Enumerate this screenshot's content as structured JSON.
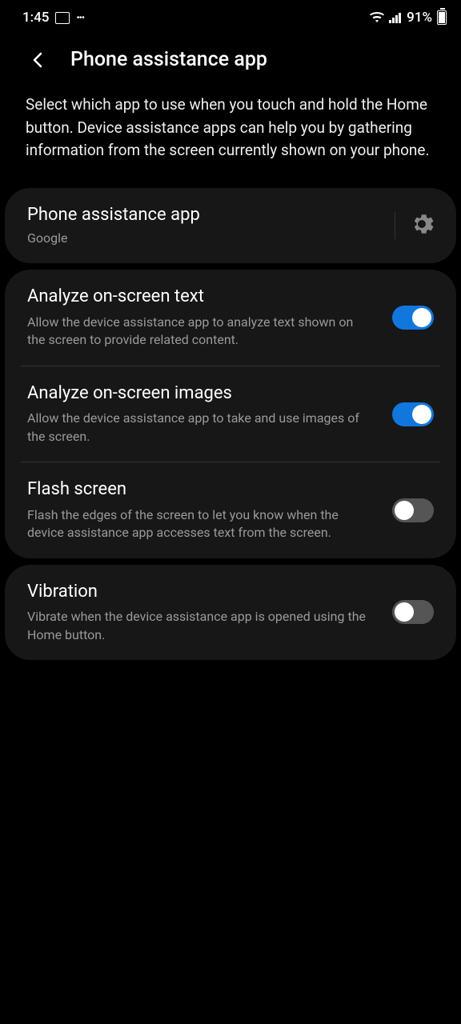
{
  "statusBar": {
    "time": "1:45",
    "batteryPercent": "91%"
  },
  "header": {
    "title": "Phone assistance app"
  },
  "description": "Select which app to use when you touch and hold the Home button. Device assistance apps can help you by gathering information from the screen currently shown on your phone.",
  "currentApp": {
    "label": "Phone assistance app",
    "value": "Google"
  },
  "settings": {
    "analyzeText": {
      "title": "Analyze on-screen text",
      "description": "Allow the device assistance app to analyze text shown on the screen to provide related content.",
      "enabled": true
    },
    "analyzeImages": {
      "title": "Analyze on-screen images",
      "description": "Allow the device assistance app to take and use images of the screen.",
      "enabled": true
    },
    "flashScreen": {
      "title": "Flash screen",
      "description": "Flash the edges of the screen to let you know when the device assistance app accesses text from the screen.",
      "enabled": false
    },
    "vibration": {
      "title": "Vibration",
      "description": "Vibrate when the device assistance app is opened using the Home button.",
      "enabled": false
    }
  }
}
